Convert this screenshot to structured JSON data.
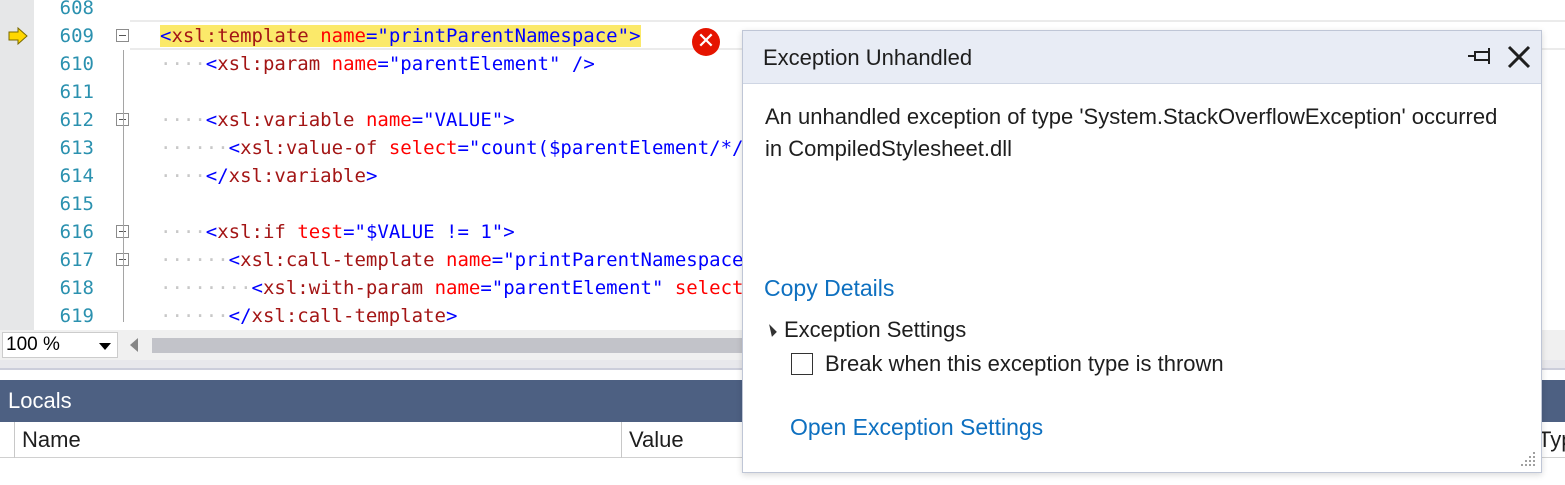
{
  "editor": {
    "lines": [
      {
        "num": "608",
        "indent": "",
        "fold": false,
        "tokens": []
      },
      {
        "num": "609",
        "indent": "",
        "fold": true,
        "current": true,
        "tokens": [
          {
            "t": "<",
            "c": "tag",
            "hl": true
          },
          {
            "t": "xsl:template",
            "c": "elem",
            "hl": true
          },
          {
            "t": " ",
            "c": "",
            "hl": true
          },
          {
            "t": "name",
            "c": "attr",
            "hl": true
          },
          {
            "t": "=",
            "c": "tag",
            "hl": true
          },
          {
            "t": "\"printParentNamespace\"",
            "c": "val",
            "hl": true
          },
          {
            "t": ">",
            "c": "tag",
            "hl": true
          }
        ]
      },
      {
        "num": "610",
        "indent": "····",
        "fold": false,
        "tokens": [
          {
            "t": "<",
            "c": "tag"
          },
          {
            "t": "xsl:param",
            "c": "elem"
          },
          {
            "t": " ",
            "c": ""
          },
          {
            "t": "name",
            "c": "attr"
          },
          {
            "t": "=",
            "c": "tag"
          },
          {
            "t": "\"parentElement\"",
            "c": "val"
          },
          {
            "t": " />",
            "c": "tag"
          }
        ]
      },
      {
        "num": "611",
        "indent": "",
        "fold": false,
        "tokens": []
      },
      {
        "num": "612",
        "indent": "····",
        "fold": true,
        "tokens": [
          {
            "t": "<",
            "c": "tag"
          },
          {
            "t": "xsl:variable",
            "c": "elem"
          },
          {
            "t": " ",
            "c": ""
          },
          {
            "t": "name",
            "c": "attr"
          },
          {
            "t": "=",
            "c": "tag"
          },
          {
            "t": "\"VALUE\"",
            "c": "val"
          },
          {
            "t": ">",
            "c": "tag"
          }
        ]
      },
      {
        "num": "613",
        "indent": "······",
        "fold": false,
        "tokens": [
          {
            "t": "<",
            "c": "tag"
          },
          {
            "t": "xsl:value-of",
            "c": "elem"
          },
          {
            "t": " ",
            "c": ""
          },
          {
            "t": "select",
            "c": "attr"
          },
          {
            "t": "=",
            "c": "tag"
          },
          {
            "t": "\"count($parentElement/*/",
            "c": "val"
          }
        ]
      },
      {
        "num": "614",
        "indent": "····",
        "fold": false,
        "tokens": [
          {
            "t": "</",
            "c": "tag"
          },
          {
            "t": "xsl:variable",
            "c": "elem"
          },
          {
            "t": ">",
            "c": "tag"
          }
        ]
      },
      {
        "num": "615",
        "indent": "",
        "fold": false,
        "tokens": []
      },
      {
        "num": "616",
        "indent": "····",
        "fold": true,
        "tokens": [
          {
            "t": "<",
            "c": "tag"
          },
          {
            "t": "xsl:if",
            "c": "elem"
          },
          {
            "t": " ",
            "c": ""
          },
          {
            "t": "test",
            "c": "attr"
          },
          {
            "t": "=",
            "c": "tag"
          },
          {
            "t": "\"$VALUE != 1\"",
            "c": "val"
          },
          {
            "t": ">",
            "c": "tag"
          }
        ]
      },
      {
        "num": "617",
        "indent": "······",
        "fold": true,
        "tokens": [
          {
            "t": "<",
            "c": "tag"
          },
          {
            "t": "xsl:call-template",
            "c": "elem"
          },
          {
            "t": " ",
            "c": ""
          },
          {
            "t": "name",
            "c": "attr"
          },
          {
            "t": "=",
            "c": "tag"
          },
          {
            "t": "\"printParentNamespace",
            "c": "val"
          }
        ]
      },
      {
        "num": "618",
        "indent": "········",
        "fold": false,
        "tokens": [
          {
            "t": "<",
            "c": "tag"
          },
          {
            "t": "xsl:with-param",
            "c": "elem"
          },
          {
            "t": " ",
            "c": ""
          },
          {
            "t": "name",
            "c": "attr"
          },
          {
            "t": "=",
            "c": "tag"
          },
          {
            "t": "\"parentElement\"",
            "c": "val"
          },
          {
            "t": " ",
            "c": ""
          },
          {
            "t": "select",
            "c": "attr"
          }
        ]
      },
      {
        "num": "619",
        "indent": "······",
        "fold": false,
        "tokens": [
          {
            "t": "</",
            "c": "tag"
          },
          {
            "t": "xsl:call-template",
            "c": "elem"
          },
          {
            "t": ">",
            "c": "tag"
          }
        ]
      }
    ]
  },
  "zoom": {
    "value": "100 %"
  },
  "locals": {
    "title": "Locals",
    "columns": {
      "name": "Name",
      "value": "Value",
      "type": "Typ"
    }
  },
  "exception": {
    "title": "Exception Unhandled",
    "message": "An unhandled exception of type 'System.StackOverflowException' occurred in CompiledStylesheet.dll",
    "copy_details": "Copy Details",
    "settings_header": "Exception Settings",
    "break_checkbox_label": "Break when this exception type is thrown",
    "break_checked": false,
    "open_settings": "Open Exception Settings"
  },
  "colors": {
    "tag": "#0000ff",
    "element": "#a31515",
    "attribute": "#ff0000",
    "value": "#0000ff",
    "line_number": "#2b91af",
    "highlight": "#fbe96a",
    "link": "#0e70c0",
    "panel_header": "#4d6082",
    "error": "#e51400"
  },
  "icons": {
    "current_line": "yellow-arrow-icon",
    "error": "error-circle-x-icon",
    "pin": "pin-icon",
    "close": "close-icon"
  }
}
